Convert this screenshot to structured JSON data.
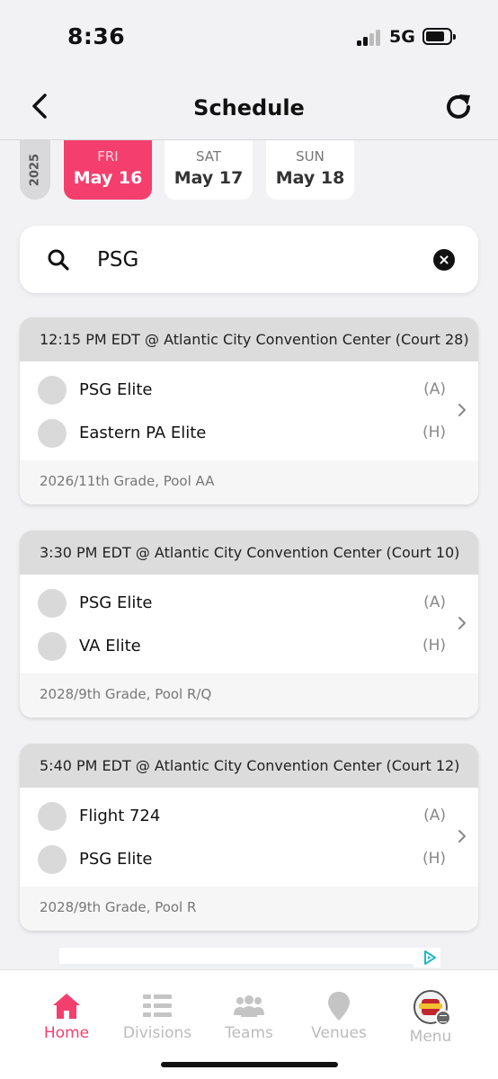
{
  "status_bar": {
    "time": "8:36",
    "network": "5G"
  },
  "header": {
    "title": "Schedule"
  },
  "date_picker": {
    "year": "2025",
    "dates": [
      {
        "dow": "FRI",
        "day": "May 16",
        "selected": true
      },
      {
        "dow": "SAT",
        "day": "May 17",
        "selected": false
      },
      {
        "dow": "SUN",
        "day": "May 18",
        "selected": false
      }
    ]
  },
  "search": {
    "value": "PSG"
  },
  "games": [
    {
      "header": "12:15 PM EDT @ Atlantic City Convention Center (Court 28)",
      "teams": [
        {
          "name": "PSG Elite",
          "side": "(A)"
        },
        {
          "name": "Eastern PA Elite",
          "side": "(H)"
        }
      ],
      "footer": "2026/11th Grade, Pool AA"
    },
    {
      "header": "3:30 PM EDT @ Atlantic City Convention Center (Court 10)",
      "teams": [
        {
          "name": "PSG Elite",
          "side": "(A)"
        },
        {
          "name": "VA Elite",
          "side": "(H)"
        }
      ],
      "footer": "2028/9th Grade, Pool R/Q"
    },
    {
      "header": "5:40 PM EDT @ Atlantic City Convention Center (Court 12)",
      "teams": [
        {
          "name": "Flight 724",
          "side": "(A)"
        },
        {
          "name": "PSG Elite",
          "side": "(H)"
        }
      ],
      "footer": "2028/9th Grade, Pool R"
    }
  ],
  "tab_bar": {
    "tabs": [
      {
        "label": "Home",
        "icon": "home-icon",
        "active": true
      },
      {
        "label": "Divisions",
        "icon": "divisions-icon",
        "active": false
      },
      {
        "label": "Teams",
        "icon": "teams-icon",
        "active": false
      },
      {
        "label": "Venues",
        "icon": "venue-pin-icon",
        "active": false
      },
      {
        "label": "Menu",
        "icon": "menu-avatar-icon",
        "active": false
      }
    ]
  },
  "colors": {
    "accent": "#f43f6e",
    "header_gray": "#dcdcdc",
    "inactive_tab": "#bbbbbb"
  }
}
